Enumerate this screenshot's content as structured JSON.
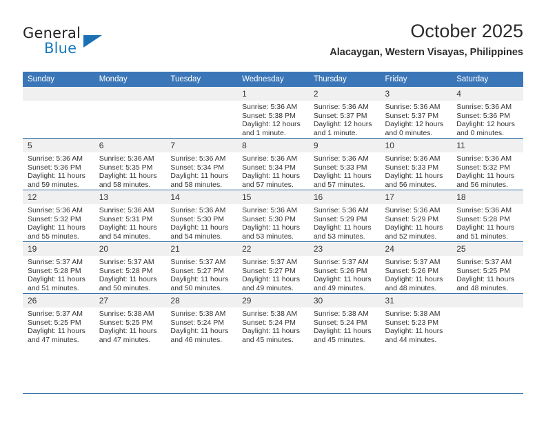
{
  "brand": {
    "name_top": "General",
    "name_bottom": "Blue",
    "color_black": "#231f20",
    "color_blue": "#1878be"
  },
  "header": {
    "title": "October 2025",
    "subtitle": "Alacaygan, Western Visayas, Philippines"
  },
  "theme": {
    "header_bg": "#3b77b8",
    "header_text": "#ffffff",
    "daynum_bg": "#f0f0f0",
    "grid_line": "#2e6da4",
    "body_text": "#333333"
  },
  "weekday_headers": [
    "Sunday",
    "Monday",
    "Tuesday",
    "Wednesday",
    "Thursday",
    "Friday",
    "Saturday"
  ],
  "weeks": [
    [
      {
        "empty": true,
        "day": "",
        "sunrise": "",
        "sunset": "",
        "daylight_line1": "",
        "daylight_line2": ""
      },
      {
        "empty": true,
        "day": "",
        "sunrise": "",
        "sunset": "",
        "daylight_line1": "",
        "daylight_line2": ""
      },
      {
        "empty": true,
        "day": "",
        "sunrise": "",
        "sunset": "",
        "daylight_line1": "",
        "daylight_line2": ""
      },
      {
        "empty": false,
        "day": "1",
        "sunrise": "Sunrise: 5:36 AM",
        "sunset": "Sunset: 5:38 PM",
        "daylight_line1": "Daylight: 12 hours",
        "daylight_line2": "and 1 minute."
      },
      {
        "empty": false,
        "day": "2",
        "sunrise": "Sunrise: 5:36 AM",
        "sunset": "Sunset: 5:37 PM",
        "daylight_line1": "Daylight: 12 hours",
        "daylight_line2": "and 1 minute."
      },
      {
        "empty": false,
        "day": "3",
        "sunrise": "Sunrise: 5:36 AM",
        "sunset": "Sunset: 5:37 PM",
        "daylight_line1": "Daylight: 12 hours",
        "daylight_line2": "and 0 minutes."
      },
      {
        "empty": false,
        "day": "4",
        "sunrise": "Sunrise: 5:36 AM",
        "sunset": "Sunset: 5:36 PM",
        "daylight_line1": "Daylight: 12 hours",
        "daylight_line2": "and 0 minutes."
      }
    ],
    [
      {
        "empty": false,
        "day": "5",
        "sunrise": "Sunrise: 5:36 AM",
        "sunset": "Sunset: 5:36 PM",
        "daylight_line1": "Daylight: 11 hours",
        "daylight_line2": "and 59 minutes."
      },
      {
        "empty": false,
        "day": "6",
        "sunrise": "Sunrise: 5:36 AM",
        "sunset": "Sunset: 5:35 PM",
        "daylight_line1": "Daylight: 11 hours",
        "daylight_line2": "and 58 minutes."
      },
      {
        "empty": false,
        "day": "7",
        "sunrise": "Sunrise: 5:36 AM",
        "sunset": "Sunset: 5:34 PM",
        "daylight_line1": "Daylight: 11 hours",
        "daylight_line2": "and 58 minutes."
      },
      {
        "empty": false,
        "day": "8",
        "sunrise": "Sunrise: 5:36 AM",
        "sunset": "Sunset: 5:34 PM",
        "daylight_line1": "Daylight: 11 hours",
        "daylight_line2": "and 57 minutes."
      },
      {
        "empty": false,
        "day": "9",
        "sunrise": "Sunrise: 5:36 AM",
        "sunset": "Sunset: 5:33 PM",
        "daylight_line1": "Daylight: 11 hours",
        "daylight_line2": "and 57 minutes."
      },
      {
        "empty": false,
        "day": "10",
        "sunrise": "Sunrise: 5:36 AM",
        "sunset": "Sunset: 5:33 PM",
        "daylight_line1": "Daylight: 11 hours",
        "daylight_line2": "and 56 minutes."
      },
      {
        "empty": false,
        "day": "11",
        "sunrise": "Sunrise: 5:36 AM",
        "sunset": "Sunset: 5:32 PM",
        "daylight_line1": "Daylight: 11 hours",
        "daylight_line2": "and 56 minutes."
      }
    ],
    [
      {
        "empty": false,
        "day": "12",
        "sunrise": "Sunrise: 5:36 AM",
        "sunset": "Sunset: 5:32 PM",
        "daylight_line1": "Daylight: 11 hours",
        "daylight_line2": "and 55 minutes."
      },
      {
        "empty": false,
        "day": "13",
        "sunrise": "Sunrise: 5:36 AM",
        "sunset": "Sunset: 5:31 PM",
        "daylight_line1": "Daylight: 11 hours",
        "daylight_line2": "and 54 minutes."
      },
      {
        "empty": false,
        "day": "14",
        "sunrise": "Sunrise: 5:36 AM",
        "sunset": "Sunset: 5:30 PM",
        "daylight_line1": "Daylight: 11 hours",
        "daylight_line2": "and 54 minutes."
      },
      {
        "empty": false,
        "day": "15",
        "sunrise": "Sunrise: 5:36 AM",
        "sunset": "Sunset: 5:30 PM",
        "daylight_line1": "Daylight: 11 hours",
        "daylight_line2": "and 53 minutes."
      },
      {
        "empty": false,
        "day": "16",
        "sunrise": "Sunrise: 5:36 AM",
        "sunset": "Sunset: 5:29 PM",
        "daylight_line1": "Daylight: 11 hours",
        "daylight_line2": "and 53 minutes."
      },
      {
        "empty": false,
        "day": "17",
        "sunrise": "Sunrise: 5:36 AM",
        "sunset": "Sunset: 5:29 PM",
        "daylight_line1": "Daylight: 11 hours",
        "daylight_line2": "and 52 minutes."
      },
      {
        "empty": false,
        "day": "18",
        "sunrise": "Sunrise: 5:36 AM",
        "sunset": "Sunset: 5:28 PM",
        "daylight_line1": "Daylight: 11 hours",
        "daylight_line2": "and 51 minutes."
      }
    ],
    [
      {
        "empty": false,
        "day": "19",
        "sunrise": "Sunrise: 5:37 AM",
        "sunset": "Sunset: 5:28 PM",
        "daylight_line1": "Daylight: 11 hours",
        "daylight_line2": "and 51 minutes."
      },
      {
        "empty": false,
        "day": "20",
        "sunrise": "Sunrise: 5:37 AM",
        "sunset": "Sunset: 5:28 PM",
        "daylight_line1": "Daylight: 11 hours",
        "daylight_line2": "and 50 minutes."
      },
      {
        "empty": false,
        "day": "21",
        "sunrise": "Sunrise: 5:37 AM",
        "sunset": "Sunset: 5:27 PM",
        "daylight_line1": "Daylight: 11 hours",
        "daylight_line2": "and 50 minutes."
      },
      {
        "empty": false,
        "day": "22",
        "sunrise": "Sunrise: 5:37 AM",
        "sunset": "Sunset: 5:27 PM",
        "daylight_line1": "Daylight: 11 hours",
        "daylight_line2": "and 49 minutes."
      },
      {
        "empty": false,
        "day": "23",
        "sunrise": "Sunrise: 5:37 AM",
        "sunset": "Sunset: 5:26 PM",
        "daylight_line1": "Daylight: 11 hours",
        "daylight_line2": "and 49 minutes."
      },
      {
        "empty": false,
        "day": "24",
        "sunrise": "Sunrise: 5:37 AM",
        "sunset": "Sunset: 5:26 PM",
        "daylight_line1": "Daylight: 11 hours",
        "daylight_line2": "and 48 minutes."
      },
      {
        "empty": false,
        "day": "25",
        "sunrise": "Sunrise: 5:37 AM",
        "sunset": "Sunset: 5:25 PM",
        "daylight_line1": "Daylight: 11 hours",
        "daylight_line2": "and 48 minutes."
      }
    ],
    [
      {
        "empty": false,
        "day": "26",
        "sunrise": "Sunrise: 5:37 AM",
        "sunset": "Sunset: 5:25 PM",
        "daylight_line1": "Daylight: 11 hours",
        "daylight_line2": "and 47 minutes."
      },
      {
        "empty": false,
        "day": "27",
        "sunrise": "Sunrise: 5:38 AM",
        "sunset": "Sunset: 5:25 PM",
        "daylight_line1": "Daylight: 11 hours",
        "daylight_line2": "and 47 minutes."
      },
      {
        "empty": false,
        "day": "28",
        "sunrise": "Sunrise: 5:38 AM",
        "sunset": "Sunset: 5:24 PM",
        "daylight_line1": "Daylight: 11 hours",
        "daylight_line2": "and 46 minutes."
      },
      {
        "empty": false,
        "day": "29",
        "sunrise": "Sunrise: 5:38 AM",
        "sunset": "Sunset: 5:24 PM",
        "daylight_line1": "Daylight: 11 hours",
        "daylight_line2": "and 45 minutes."
      },
      {
        "empty": false,
        "day": "30",
        "sunrise": "Sunrise: 5:38 AM",
        "sunset": "Sunset: 5:24 PM",
        "daylight_line1": "Daylight: 11 hours",
        "daylight_line2": "and 45 minutes."
      },
      {
        "empty": false,
        "day": "31",
        "sunrise": "Sunrise: 5:38 AM",
        "sunset": "Sunset: 5:23 PM",
        "daylight_line1": "Daylight: 11 hours",
        "daylight_line2": "and 44 minutes."
      },
      {
        "empty": true,
        "day": "",
        "sunrise": "",
        "sunset": "",
        "daylight_line1": "",
        "daylight_line2": ""
      }
    ]
  ]
}
